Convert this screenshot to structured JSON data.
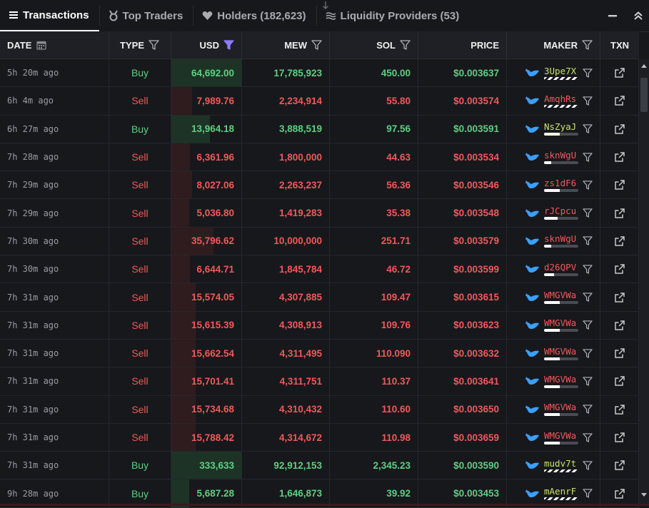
{
  "tabs": [
    {
      "label": "Transactions",
      "icon": "list-icon",
      "active": true
    },
    {
      "label": "Top Traders",
      "icon": "medal-icon",
      "active": false
    },
    {
      "label": "Holders (182,623)",
      "icon": "heart-icon",
      "active": false
    },
    {
      "label": "Liquidity Providers (53)",
      "icon": "liquidity-icon",
      "active": false
    }
  ],
  "columns": {
    "date": "DATE",
    "type": "TYPE",
    "usd": "USD",
    "mew": "MEW",
    "sol": "SOL",
    "price": "PRICE",
    "maker": "MAKER",
    "txn": "TXN"
  },
  "colors": {
    "buy": "#5fcf80",
    "sell": "#f0595a",
    "active_filter": "#8a7dff"
  },
  "rows": [
    {
      "date": "5h 20m ago",
      "type": "Buy",
      "usd": "64,692.00",
      "mew": "17,785,923",
      "sol": "450.00",
      "price": "$0.003637",
      "maker": "3Upe7X",
      "maker_bar": "striped",
      "usd_fill": 1.0
    },
    {
      "date": "6h 4m ago",
      "type": "Sell",
      "usd": "7,989.76",
      "mew": "2,234,914",
      "sol": "55.80",
      "price": "$0.003574",
      "maker": "AmqhRs",
      "maker_bar": "striped",
      "usd_fill": 0.3
    },
    {
      "date": "6h 27m ago",
      "type": "Buy",
      "usd": "13,964.18",
      "mew": "3,888,519",
      "sol": "97.56",
      "price": "$0.003591",
      "maker": "NsZyaJ",
      "maker_bar": 0.45,
      "usd_fill": 0.55
    },
    {
      "date": "7h 28m ago",
      "type": "Sell",
      "usd": "6,361.96",
      "mew": "1,800,000",
      "sol": "44.63",
      "price": "$0.003534",
      "maker": "sknWgU",
      "maker_bar": 0.2,
      "usd_fill": 0.27
    },
    {
      "date": "7h 29m ago",
      "type": "Sell",
      "usd": "8,027.06",
      "mew": "2,263,237",
      "sol": "56.36",
      "price": "$0.003546",
      "maker": "zs1dF6",
      "maker_bar": 0.45,
      "usd_fill": 0.3
    },
    {
      "date": "7h 29m ago",
      "type": "Sell",
      "usd": "5,036.80",
      "mew": "1,419,283",
      "sol": "35.38",
      "price": "$0.003548",
      "maker": "rJCpcu",
      "maker_bar": 0.4,
      "usd_fill": 0.25
    },
    {
      "date": "7h 30m ago",
      "type": "Sell",
      "usd": "35,796.62",
      "mew": "10,000,000",
      "sol": "251.71",
      "price": "$0.003579",
      "maker": "sknWgU",
      "maker_bar": 0.2,
      "usd_fill": 0.6
    },
    {
      "date": "7h 30m ago",
      "type": "Sell",
      "usd": "6,644.71",
      "mew": "1,845,784",
      "sol": "46.72",
      "price": "$0.003599",
      "maker": "d26QPV",
      "maker_bar": 0.3,
      "usd_fill": 0.27
    },
    {
      "date": "7h 31m ago",
      "type": "Sell",
      "usd": "15,574.05",
      "mew": "4,307,885",
      "sol": "109.47",
      "price": "$0.003615",
      "maker": "WMGVWa",
      "maker_bar": 0.45,
      "usd_fill": 0.35
    },
    {
      "date": "7h 31m ago",
      "type": "Sell",
      "usd": "15,615.39",
      "mew": "4,308,913",
      "sol": "109.76",
      "price": "$0.003623",
      "maker": "WMGVWa",
      "maker_bar": 0.45,
      "usd_fill": 0.35
    },
    {
      "date": "7h 31m ago",
      "type": "Sell",
      "usd": "15,662.54",
      "mew": "4,311,495",
      "sol": "110.090",
      "price": "$0.003632",
      "maker": "WMGVWa",
      "maker_bar": 0.45,
      "usd_fill": 0.35
    },
    {
      "date": "7h 31m ago",
      "type": "Sell",
      "usd": "15,701.41",
      "mew": "4,311,751",
      "sol": "110.37",
      "price": "$0.003641",
      "maker": "WMGVWa",
      "maker_bar": 0.45,
      "usd_fill": 0.35
    },
    {
      "date": "7h 31m ago",
      "type": "Sell",
      "usd": "15,734.68",
      "mew": "4,310,432",
      "sol": "110.60",
      "price": "$0.003650",
      "maker": "WMGVWa",
      "maker_bar": 0.45,
      "usd_fill": 0.35
    },
    {
      "date": "7h 31m ago",
      "type": "Sell",
      "usd": "15,788.42",
      "mew": "4,314,672",
      "sol": "110.98",
      "price": "$0.003659",
      "maker": "WMGVWa",
      "maker_bar": 0.45,
      "usd_fill": 0.35
    },
    {
      "date": "7h 31m ago",
      "type": "Buy",
      "usd": "333,633",
      "mew": "92,912,153",
      "sol": "2,345.23",
      "price": "$0.003590",
      "maker": "mudv7t",
      "maker_bar": "striped",
      "usd_fill": 1.0
    },
    {
      "date": "9h 28m ago",
      "type": "Buy",
      "usd": "5,687.28",
      "mew": "1,646,873",
      "sol": "39.92",
      "price": "$0.003453",
      "maker": "mAenrF",
      "maker_bar": "striped",
      "usd_fill": 0.25
    }
  ]
}
